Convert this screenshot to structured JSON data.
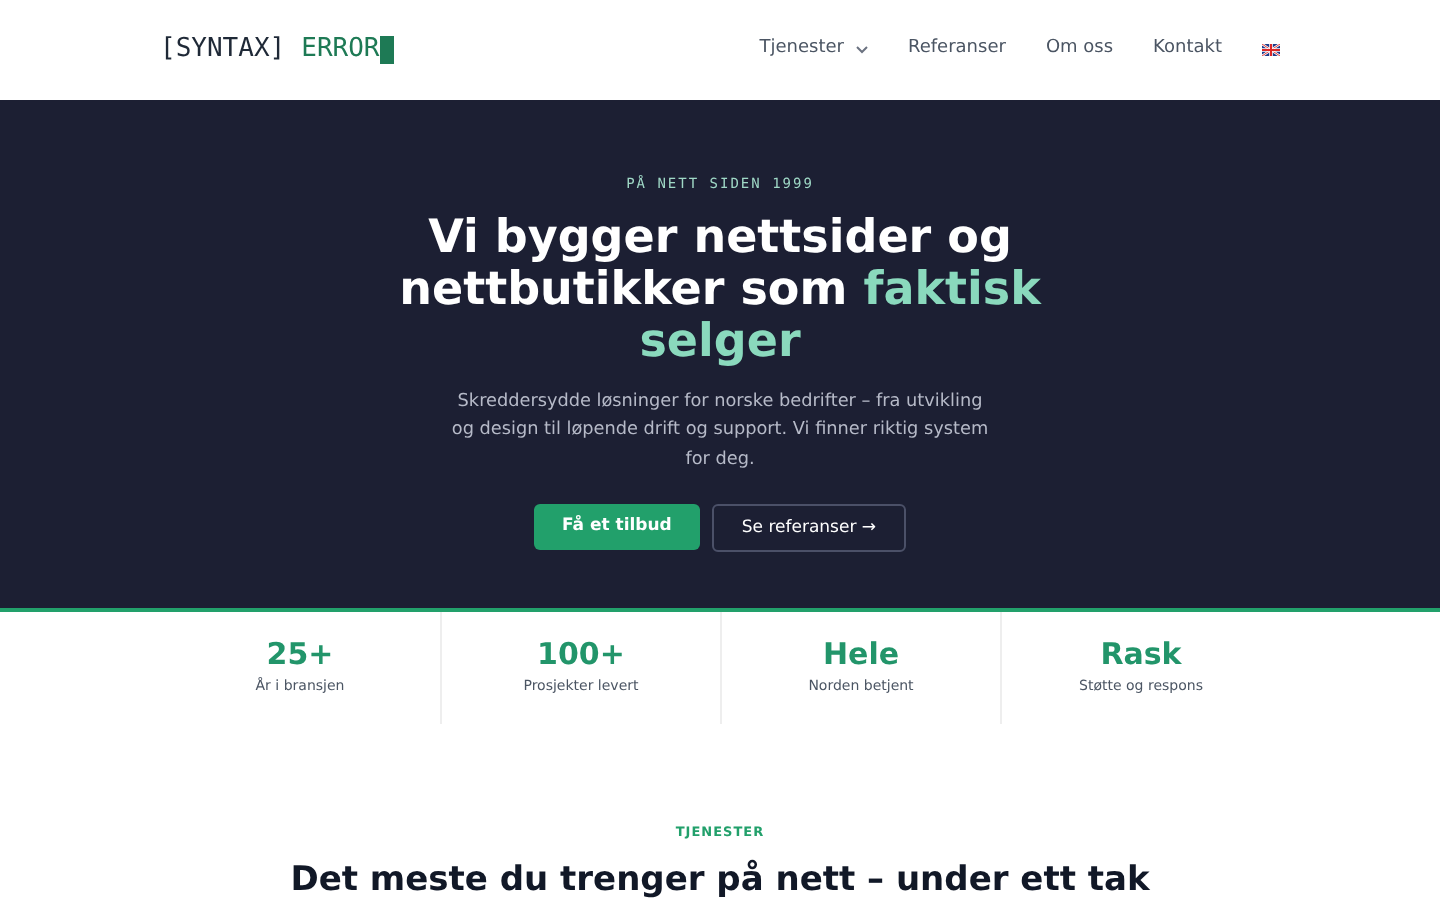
{
  "header": {
    "logo": {
      "bracket": "[SYNTAX]",
      "word": "ERROR"
    },
    "nav": [
      {
        "label": "Tjenester",
        "dropdown": true
      },
      {
        "label": "Referanser",
        "dropdown": false
      },
      {
        "label": "Om oss",
        "dropdown": false
      },
      {
        "label": "Kontakt",
        "dropdown": false
      }
    ]
  },
  "hero": {
    "eyebrow": "PÅ NETT SIDEN 1999",
    "headline": "Vi bygger nettsider og nettbutikker som",
    "headline_accent": "faktisk selger",
    "lead": "Skreddersydde løsninger for norske bedrifter – fra utvikling og design til løpende drift og support. Vi finner riktig system for deg.",
    "buttons": [
      {
        "label": "Få et tilbud",
        "kind": "primary"
      },
      {
        "label": "Se referanser →",
        "kind": "outline"
      }
    ]
  },
  "stats": [
    {
      "value": "25+",
      "label": "År i bransjen"
    },
    {
      "value": "100+",
      "label": "Prosjekter levert"
    },
    {
      "value": "Hele",
      "label": "Norden betjent"
    },
    {
      "value": "Rask",
      "label": "Støtte og respons"
    }
  ],
  "services": {
    "eyebrow": "TJENESTER",
    "title": "Det meste du trenger på nett – under ett tak"
  }
}
